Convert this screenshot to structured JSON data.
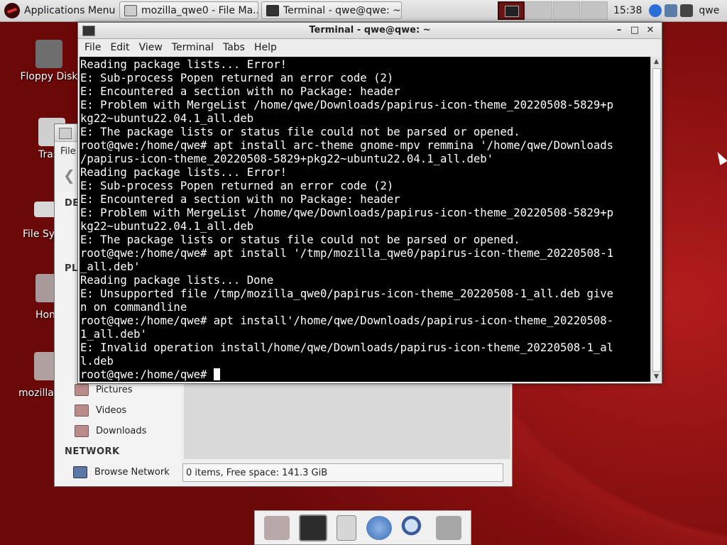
{
  "top_panel": {
    "apps_menu_label": "Applications Menu",
    "tasks": [
      {
        "label": "mozilla_qwe0 - File Ma..."
      },
      {
        "label": "Terminal - qwe@qwe: ~"
      }
    ],
    "clock": "15:38",
    "user": "qwe"
  },
  "desktop_icons": [
    {
      "label": "Floppy Disk",
      "icon": "floppy-disk-icon"
    },
    {
      "label": "Tras",
      "icon": "trash-icon"
    },
    {
      "label": "File Sy",
      "icon": "drive-icon"
    },
    {
      "label": "Hon",
      "icon": "home-folder-icon"
    },
    {
      "label": "mozilla_",
      "icon": "folder-icon"
    }
  ],
  "file_manager": {
    "menu_first": "File",
    "sidebar": {
      "devices_header": "DE",
      "places_header": "PL",
      "items": [
        {
          "label": "Pictures",
          "icon": "pictures-folder-icon"
        },
        {
          "label": "Videos",
          "icon": "videos-folder-icon"
        },
        {
          "label": "Downloads",
          "icon": "downloads-folder-icon"
        }
      ],
      "network_header": "NETWORK",
      "network_item": {
        "label": "Browse Network",
        "icon": "network-icon"
      }
    },
    "status": "0 items, Free space: 141.3 GiB"
  },
  "terminal": {
    "title": "Terminal - qwe@qwe: ~",
    "menu": [
      "File",
      "Edit",
      "View",
      "Terminal",
      "Tabs",
      "Help"
    ],
    "lines": [
      "Reading package lists... Error!",
      "E: Sub-process Popen returned an error code (2)",
      "E: Encountered a section with no Package: header",
      "E: Problem with MergeList /home/qwe/Downloads/papirus-icon-theme_20220508-5829+p",
      "kg22~ubuntu22.04.1_all.deb",
      "E: The package lists or status file could not be parsed or opened.",
      "root@qwe:/home/qwe# apt install arc-theme gnome-mpv remmina '/home/qwe/Downloads",
      "/papirus-icon-theme_20220508-5829+pkg22~ubuntu22.04.1_all.deb'",
      "Reading package lists... Error!",
      "E: Sub-process Popen returned an error code (2)",
      "E: Encountered a section with no Package: header",
      "E: Problem with MergeList /home/qwe/Downloads/papirus-icon-theme_20220508-5829+p",
      "kg22~ubuntu22.04.1_all.deb",
      "E: The package lists or status file could not be parsed or opened.",
      "root@qwe:/home/qwe# apt install '/tmp/mozilla_qwe0/papirus-icon-theme_20220508-1",
      "_all.deb'",
      "Reading package lists... Done",
      "E: Unsupported file /tmp/mozilla_qwe0/papirus-icon-theme_20220508-1_all.deb give",
      "n on commandline",
      "root@qwe:/home/qwe# apt install'/home/qwe/Downloads/papirus-icon-theme_20220508-",
      "1_all.deb'",
      "E: Invalid operation install/home/qwe/Downloads/papirus-icon-theme_20220508-1_al",
      "l.deb"
    ],
    "prompt": "root@qwe:/home/qwe# "
  },
  "dock": [
    {
      "icon": "home-folder-icon"
    },
    {
      "icon": "terminal-icon"
    },
    {
      "icon": "file-manager-icon"
    },
    {
      "icon": "web-browser-icon"
    },
    {
      "icon": "search-icon"
    },
    {
      "icon": "folder-icon"
    }
  ],
  "colors": {
    "desktop_bg": "#8a1010",
    "terminal_bg": "#000000",
    "terminal_fg": "#ffffff"
  }
}
